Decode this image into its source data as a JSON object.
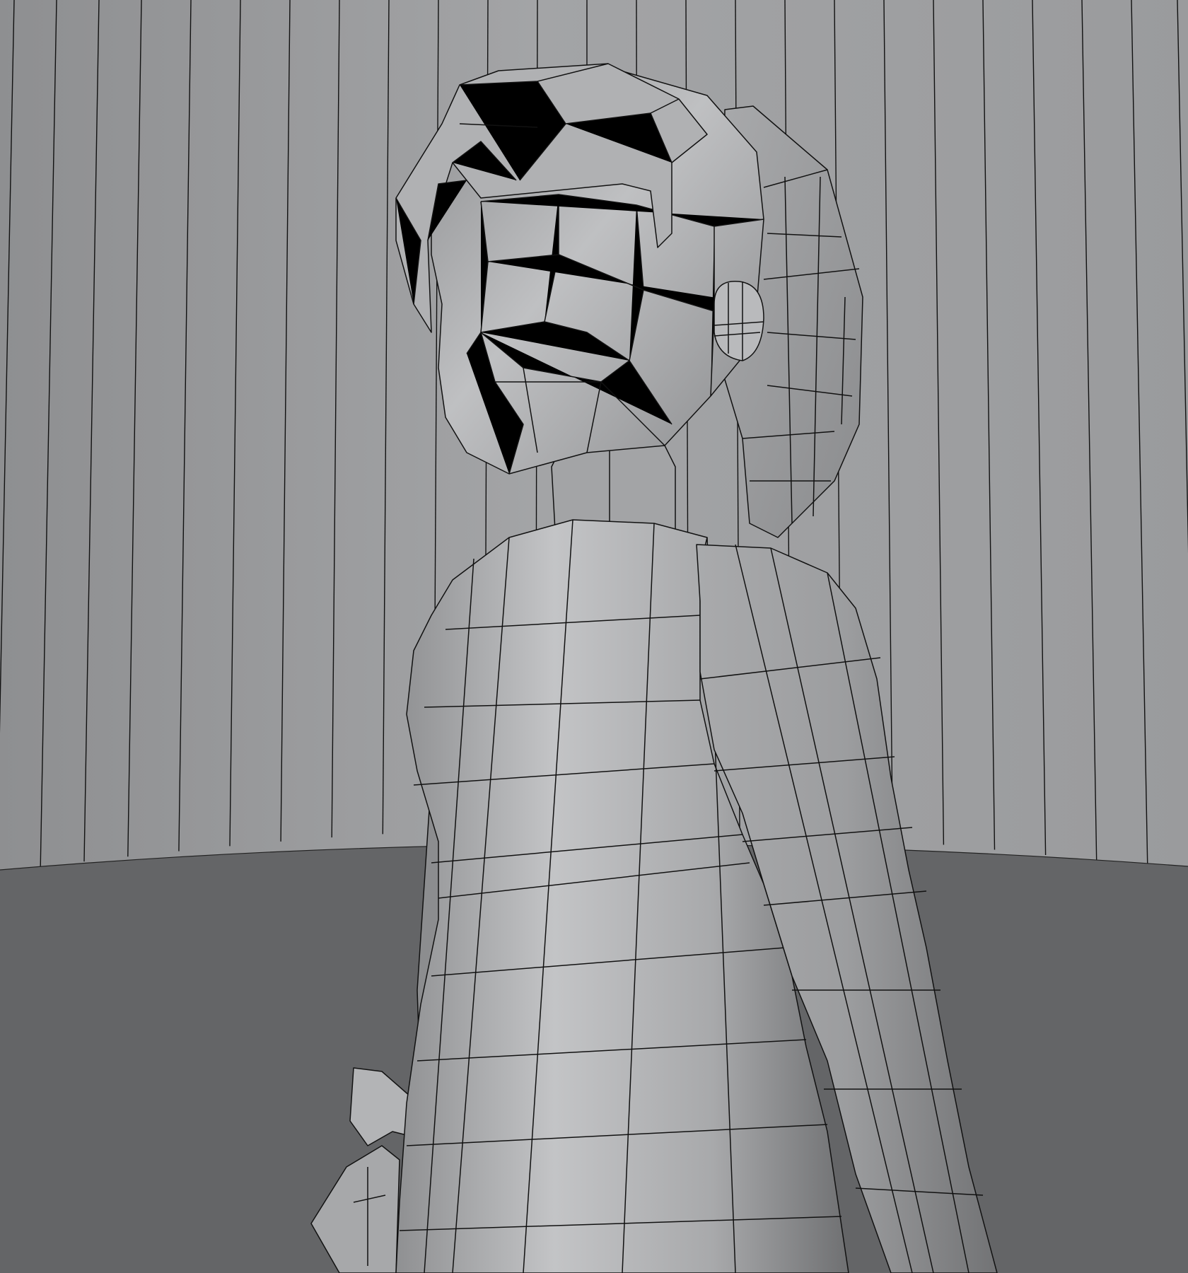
{
  "scene": {
    "kind": "3d-viewport-render",
    "shading": "solid-wireframe",
    "colors": {
      "backdrop_wall": "#9c9d9f",
      "floor": "#646567",
      "mesh_light": "#c2c3c5",
      "mesh_mid": "#a4a5a7",
      "mesh_dark": "#7a7b7d",
      "edge_line": "#111111"
    },
    "objects": [
      {
        "name": "backdrop-wall",
        "icon": "cylinder-backdrop"
      },
      {
        "name": "floor-plane",
        "icon": "plane"
      },
      {
        "name": "character-mesh",
        "icon": "low-poly-figure"
      }
    ]
  }
}
